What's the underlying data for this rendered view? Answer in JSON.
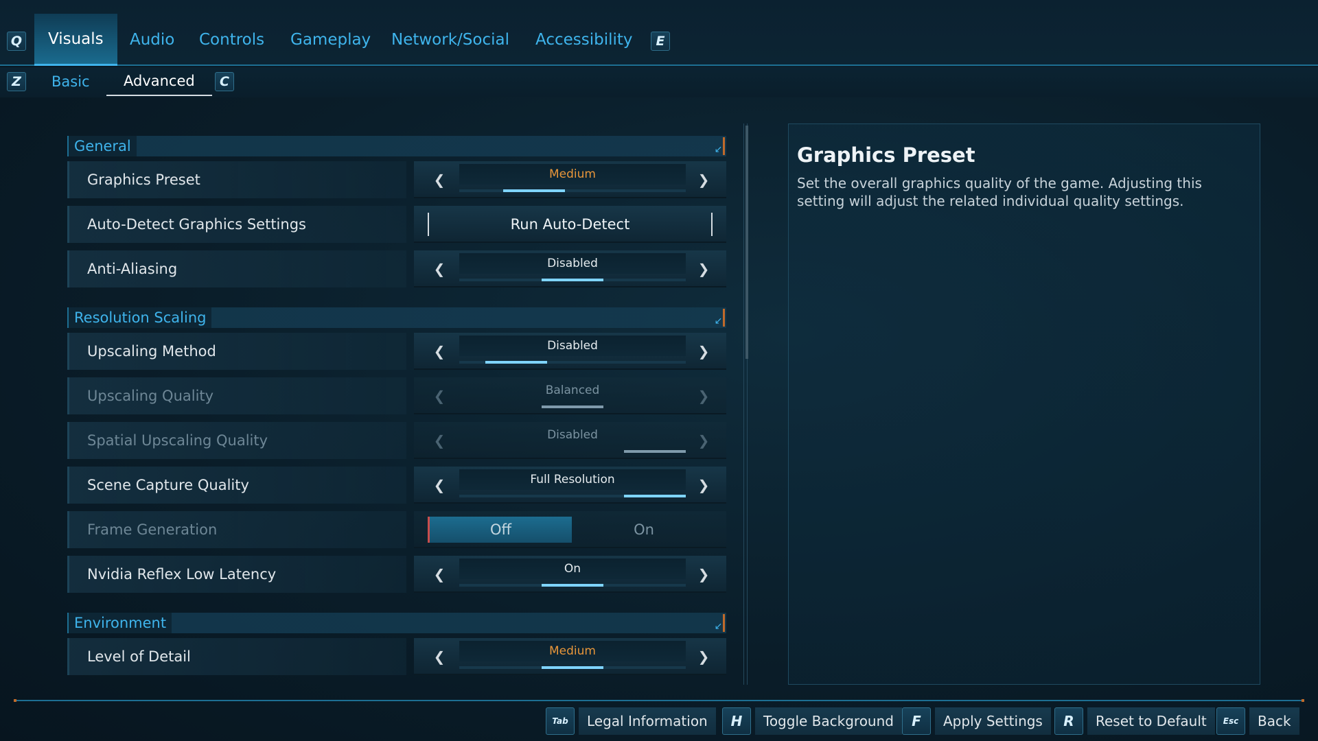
{
  "top_tabs": {
    "left_key": "Q",
    "right_key": "E",
    "items": [
      {
        "label": "Visuals",
        "active": true
      },
      {
        "label": "Audio"
      },
      {
        "label": "Controls"
      },
      {
        "label": "Gameplay"
      },
      {
        "label": "Network/Social"
      },
      {
        "label": "Accessibility"
      }
    ]
  },
  "sub_tabs": {
    "left_key": "Z",
    "right_key": "C",
    "items": [
      {
        "label": "Basic"
      },
      {
        "label": "Advanced",
        "active": true
      }
    ]
  },
  "sections": {
    "general": {
      "title": "General",
      "graphics_preset": {
        "label": "Graphics Preset",
        "value": "Medium",
        "level": 0.33
      },
      "auto_detect": {
        "label": "Auto-Detect Graphics Settings",
        "button": "Run Auto-Detect"
      },
      "anti_aliasing": {
        "label": "Anti-Aliasing",
        "value": "Disabled",
        "level": 0.5
      }
    },
    "resolution_scaling": {
      "title": "Resolution Scaling",
      "upscaling_method": {
        "label": "Upscaling Method",
        "value": "Disabled",
        "level": 0.25
      },
      "upscaling_quality": {
        "label": "Upscaling Quality",
        "value": "Balanced",
        "level": 0.5,
        "enabled": false
      },
      "spatial_upscaling_quality": {
        "label": "Spatial Upscaling Quality",
        "value": "Disabled",
        "level": 1.0,
        "enabled": false
      },
      "scene_capture_quality": {
        "label": "Scene Capture Quality",
        "value": "Full Resolution",
        "level": 1.0
      },
      "frame_generation": {
        "label": "Frame Generation",
        "options": [
          "Off",
          "On"
        ],
        "selected": "Off",
        "enabled": false
      },
      "nvidia_reflex": {
        "label": "Nvidia Reflex Low Latency",
        "value": "On",
        "level": 0.5
      }
    },
    "environment": {
      "title": "Environment",
      "level_of_detail": {
        "label": "Level of Detail",
        "value": "Medium",
        "level": 0.5
      }
    }
  },
  "info_panel": {
    "title": "Graphics Preset",
    "description": "Set the overall graphics quality of the game. Adjusting this setting will adjust the related individual quality settings."
  },
  "footer": {
    "hints": [
      {
        "key": "Tab",
        "label": "Legal Information"
      },
      {
        "key": "H",
        "label": "Toggle Background"
      },
      {
        "key": "F",
        "label": "Apply Settings"
      },
      {
        "key": "R",
        "label": "Reset to Default"
      },
      {
        "key": "Esc",
        "label": "Back"
      }
    ]
  },
  "colors": {
    "accent": "#3fb4ec",
    "highlight_value": "#e8963a",
    "background": "#0a1d29"
  }
}
